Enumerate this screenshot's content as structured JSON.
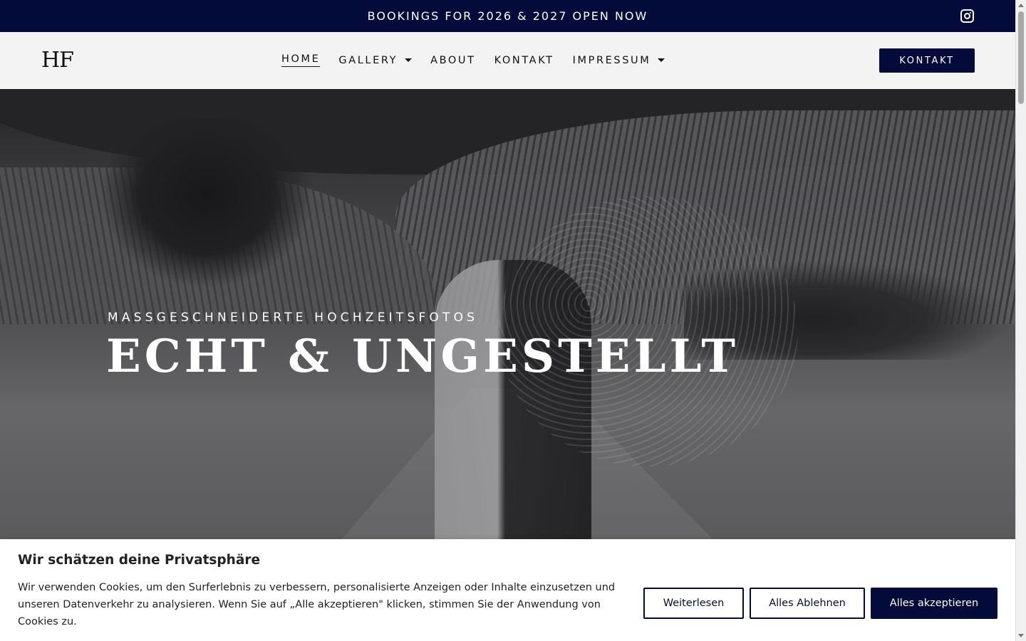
{
  "topbar": {
    "text": "BOOKINGS FOR 2026 & 2027 OPEN NOW",
    "icon": "instagram-icon"
  },
  "header": {
    "logo": "HF",
    "nav": [
      {
        "label": "HOME",
        "active": true,
        "dropdown": false
      },
      {
        "label": "GALLERY",
        "active": false,
        "dropdown": true
      },
      {
        "label": "ABOUT",
        "active": false,
        "dropdown": false
      },
      {
        "label": "KONTAKT",
        "active": false,
        "dropdown": false
      },
      {
        "label": "IMPRESSUM",
        "active": false,
        "dropdown": true
      }
    ],
    "cta": "KONTAKT"
  },
  "hero": {
    "subtitle": "MASSGESCHNEIDERTE HOCHZEITSFOTOS",
    "title": "ECHT & UNGESTELLT"
  },
  "cookie": {
    "title": "Wir schätzen deine Privatsphäre",
    "text": "Wir verwenden Cookies, um den Surferlebnis zu verbessern, personalisierte Anzeigen oder Inhalte einzusetzen und unseren Datenverkehr zu analysieren. Wenn Sie auf „Alle akzeptieren\" klicken, stimmen Sie der Anwendung von Cookies zu.",
    "read_more": "Weiterlesen",
    "deny": "Alles Ablehnen",
    "accept": "Alles akzeptieren"
  },
  "colors": {
    "brand": "#030b3a",
    "background": "#f3f3f3"
  }
}
